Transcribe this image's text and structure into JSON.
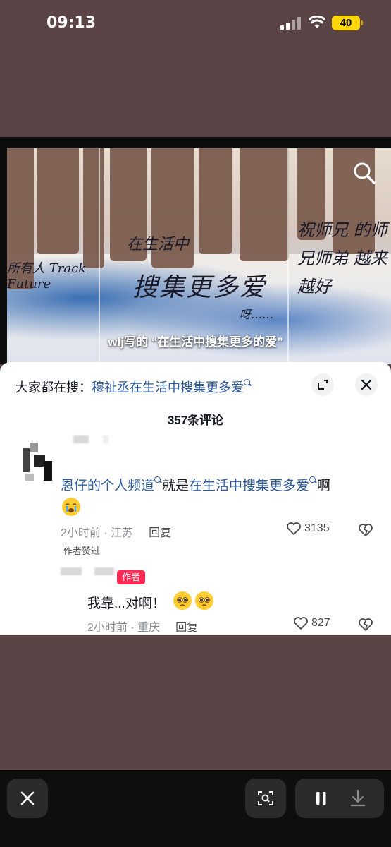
{
  "status_bar": {
    "time": "09:13",
    "battery": "40"
  },
  "video": {
    "caption": "wlj写的 “在生活中搜集更多的爱”",
    "handwriting": {
      "left": "所有人 Track Future",
      "center_top": "在生活中",
      "center_main": "搜集更多爱",
      "center_tail": "呀……",
      "right": "祝师兄 的师兄师弟 越来越好"
    }
  },
  "comments_sheet": {
    "search_prefix": "大家都在搜：",
    "search_query": "穆祉丞在生活中搜集更多爱",
    "count": "357条评论",
    "comment": {
      "text_link1": "恩仔的个人频道",
      "text_mid": "就是",
      "text_link2": "在生活中搜集更多爱",
      "text_end": "啊",
      "time_location": "2小时前 · 江苏",
      "reply_label": "回复",
      "likes": "3135",
      "author_liked": "作者赞过"
    },
    "reply": {
      "author_tag": "作者",
      "text": "我靠...对啊！",
      "time_location": "2小时前 · 重庆",
      "reply_label": "回复",
      "likes": "827"
    }
  },
  "icons": [
    "search-icon",
    "expand-icon",
    "close-icon",
    "heart-icon",
    "dislike-heart-icon",
    "scan-icon",
    "pause-icon",
    "download-icon"
  ],
  "colors": {
    "link": "#2b5a9f",
    "author_tag": "#fe2c55",
    "battery": "#ffd60a"
  }
}
